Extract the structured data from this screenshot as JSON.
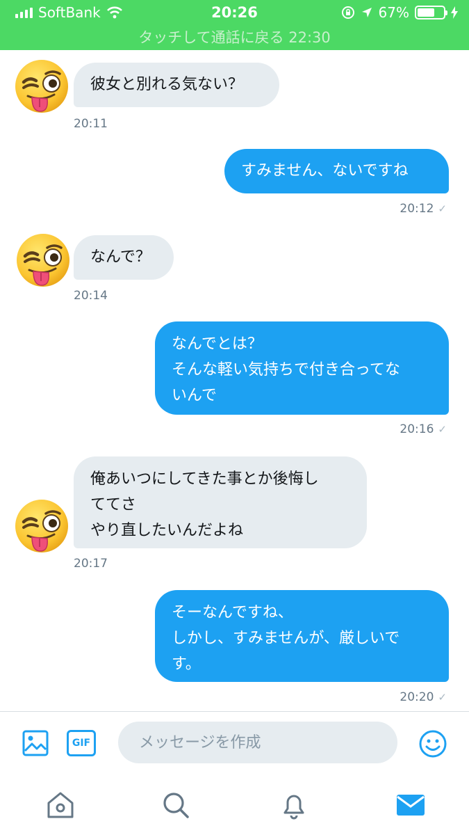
{
  "status_bar": {
    "carrier": "SoftBank",
    "time": "20:26",
    "battery": "67%",
    "battery_level": 0.67,
    "call_banner": "タッチして通話に戻る 22:30"
  },
  "messages": [
    {
      "direction": "in",
      "lines": [
        "彼女と別れる気ない？"
      ],
      "time": "20:11"
    },
    {
      "direction": "out",
      "lines": [
        "すみません、ないですね"
      ],
      "time": "20:12"
    },
    {
      "direction": "in",
      "lines": [
        "なんで？"
      ],
      "time": "20:14"
    },
    {
      "direction": "out",
      "lines": [
        "なんでとは？",
        "そんな軽い気持ちで付き合ってな",
        "いんで"
      ],
      "time": "20:16"
    },
    {
      "direction": "in",
      "lines": [
        "俺あいつにしてきた事とか後悔し",
        "ててさ",
        "やり直したいんだよね"
      ],
      "time": "20:17"
    },
    {
      "direction": "out",
      "lines": [
        "そーなんですね、",
        "しかし、すみませんが、厳しいで",
        "す。"
      ],
      "time": "20:20"
    }
  ],
  "composer": {
    "placeholder": "メッセージを作成",
    "gif_label": "GIF"
  },
  "tabbar": [
    "home",
    "search",
    "notifications",
    "messages"
  ],
  "colors": {
    "status_green": "#4cd964",
    "outgoing_bubble": "#1da1f2",
    "incoming_bubble": "#e6ecf0",
    "accent": "#1da1f2"
  }
}
